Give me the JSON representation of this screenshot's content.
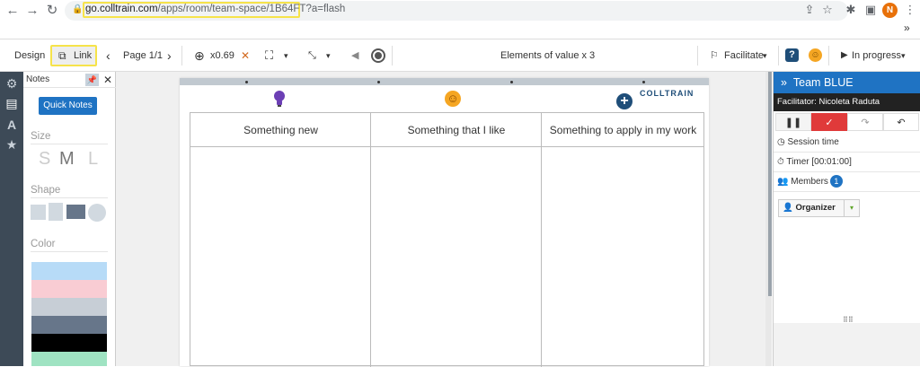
{
  "browser": {
    "back": "←",
    "forward": "→",
    "reload": "↻",
    "url_domain": "go.colltrain.com",
    "url_path": "/apps/room/team-space/1B64FT?a=flash",
    "avatar_initial": "N",
    "overflow": "»"
  },
  "toolbar": {
    "design": "Design",
    "link": "Link",
    "page": "Page 1/1",
    "prev": "‹",
    "next": "›",
    "zoom": "x0.69",
    "close": "✕",
    "elements": "Elements of value x 3",
    "facilitate": "Facilitate",
    "status": "In progress",
    "help": "?",
    "caret": "▾"
  },
  "notes_panel": {
    "title": "Notes",
    "quick_notes": "Quick Notes",
    "size_label": "Size",
    "sizes": [
      "S",
      "M",
      "L"
    ],
    "shape_label": "Shape",
    "color_label": "Color",
    "colors": [
      "#b7dbf7",
      "#f9ccd3",
      "#c7ced6",
      "#67768a",
      "#000000",
      "#9fe3c2"
    ]
  },
  "board": {
    "columns": [
      "Something new",
      "Something that I like",
      "Something to apply in my work"
    ],
    "logo_text": "COLLTRAIN",
    "icons": {
      "bulb": "#6c3fb5",
      "smile": "#f5a623",
      "add": "#1f4e79"
    }
  },
  "right_panel": {
    "team": "Team BLUE",
    "expand": "»",
    "facilitator": "Facilitator: Nicoleta Raduta",
    "session_time": "Session time",
    "timer": "Timer [00:01:00]",
    "members": "Members",
    "members_count": "1",
    "organizer": "Organizer",
    "grip": "⠿⠿"
  },
  "colors": {
    "accent": "#1f73c3",
    "danger": "#e03a3a",
    "sidebar": "#3d4a57",
    "highlight": "#f6e34a"
  }
}
